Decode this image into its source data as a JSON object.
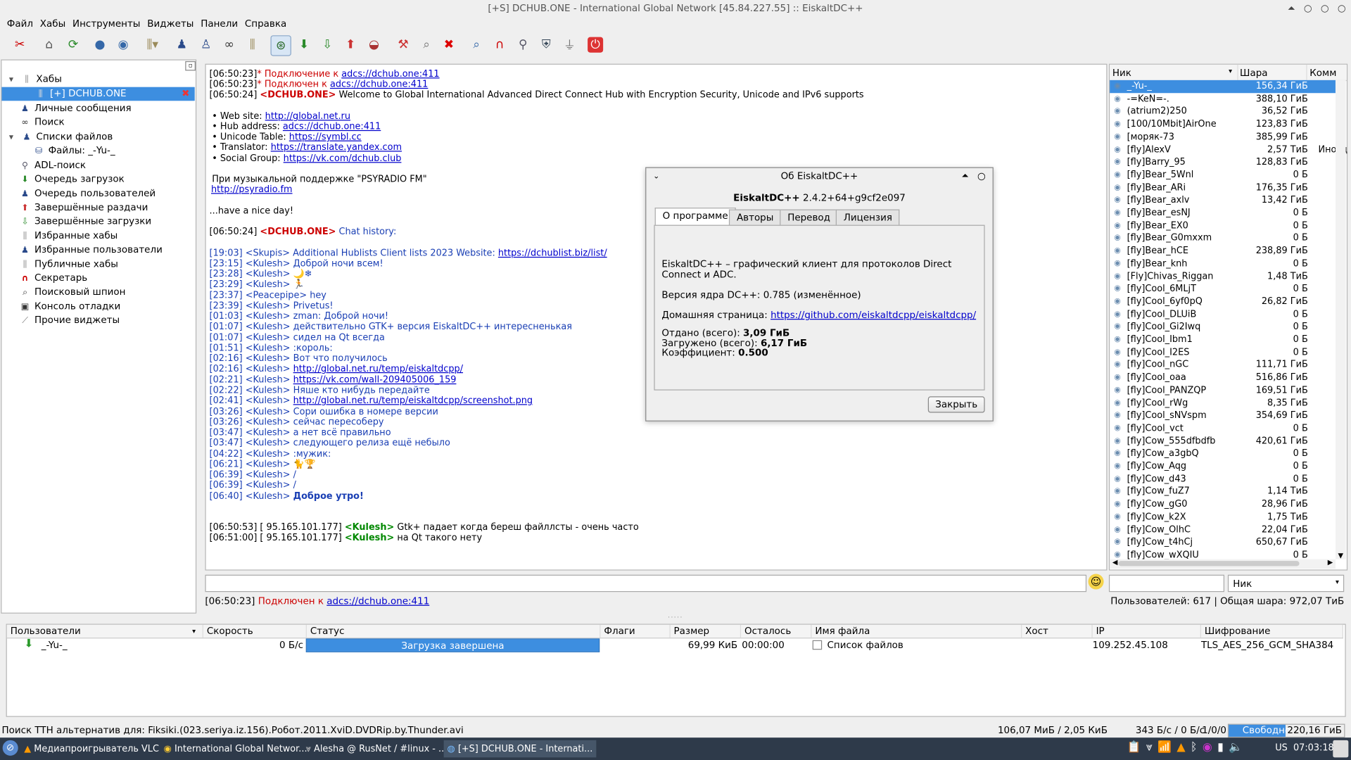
{
  "window": {
    "title": "[+S] DCHUB.ONE - International Global Network [45.84.227.55] :: EiskaltDC++"
  },
  "menu": [
    "Файл",
    "Хабы",
    "Инструменты",
    "Виджеты",
    "Панели",
    "Справка"
  ],
  "sidebar": {
    "items": [
      {
        "label": "Хабы",
        "icon": "hubs-icon"
      },
      {
        "label": "[+] DCHUB.ONE",
        "icon": "hub-connected-icon",
        "selected": true
      },
      {
        "label": "Личные сообщения",
        "icon": "user-icon"
      },
      {
        "label": "Поиск",
        "icon": "binoculars-icon"
      },
      {
        "label": "Списки файлов",
        "icon": "filelist-icon"
      },
      {
        "label": "Файлы: _-Yu-_",
        "icon": "user-icon"
      },
      {
        "label": "ADL-поиск",
        "icon": "adl-icon"
      },
      {
        "label": "Очередь загрузок",
        "icon": "download-queue-icon"
      },
      {
        "label": "Очередь пользователей",
        "icon": "user-icon"
      },
      {
        "label": "Завершённые раздачи",
        "icon": "upload-finished-icon"
      },
      {
        "label": "Завершённые загрузки",
        "icon": "download-finished-icon"
      },
      {
        "label": "Избранные хабы",
        "icon": "fav-hubs-icon"
      },
      {
        "label": "Избранные пользователи",
        "icon": "fav-users-icon"
      },
      {
        "label": "Публичные хабы",
        "icon": "public-hubs-icon"
      },
      {
        "label": "Секретарь",
        "icon": "magnet-icon"
      },
      {
        "label": "Поисковый шпион",
        "icon": "spy-icon"
      },
      {
        "label": "Консоль отладки",
        "icon": "console-icon"
      },
      {
        "label": "Прочие виджеты",
        "icon": "widgets-icon"
      }
    ]
  },
  "chat": {
    "lines": [
      {
        "ts": "[06:50:23]",
        "star": "*",
        "text": " Подключение к ",
        "link": "adcs://dchub.one:411"
      },
      {
        "ts": "[06:50:23]",
        "star": "*",
        "text": " Подключен к ",
        "link": "adcs://dchub.one:411"
      },
      {
        "ts": "[06:50:24]",
        "nick": "<DCHUB.ONE>",
        "text": " Welcome to Global International Advanced Direct Connect Hub with Encryption Security, Unicode and IPv6 supports"
      },
      {
        "text": ""
      },
      {
        "text": "• Web site: ",
        "link": "http://global.net.ru"
      },
      {
        "text": "• Hub address: ",
        "link": "adcs://dchub.one:411"
      },
      {
        "text": "• Unicode Table: ",
        "link": "https://symbl.cc"
      },
      {
        "text": "• Translator: ",
        "link": "https://translate.yandex.com"
      },
      {
        "text": "• Social Group: ",
        "link": "https://vk.com/dchub.club"
      },
      {
        "text": ""
      },
      {
        "text": "При музыкальной поддержке \"PSYRADIO FM\""
      },
      {
        "text": "",
        "link": "http://psyradio.fm"
      },
      {
        "text": ""
      },
      {
        "text": "...have a nice day!"
      },
      {
        "text": ""
      },
      {
        "ts": "[06:50:24]",
        "nick": "<DCHUB.ONE>",
        "history": " Chat history:"
      },
      {
        "text": ""
      },
      {
        "h": "[19:03] <Skupis> Additional Hublists Client lists 2023  Website:   ",
        "link": "https://dchublist.biz/list/"
      },
      {
        "h": "[23:15] <Kulesh> Доброй ночи всем!"
      },
      {
        "h": "[23:28] <Kulesh> 🌙❄"
      },
      {
        "h": "[23:29] <Kulesh> 🏃"
      },
      {
        "h": "[23:37] <Peacepipe> hey"
      },
      {
        "h": "[23:39] <Kulesh> Privetus!"
      },
      {
        "h": "[01:03] <Kulesh> zman: Доброй ночи!"
      },
      {
        "h": "[01:07] <Kulesh> действительно GTK+ версия EiskaltDC++ интересненькая"
      },
      {
        "h": "[01:07] <Kulesh> сидел на Qt всегда"
      },
      {
        "h": "[01:51] <Kulesh> :король:"
      },
      {
        "h": "[02:16] <Kulesh> Вот что получилось"
      },
      {
        "h": "[02:16] <Kulesh> ",
        "link": "http://global.net.ru/temp/eiskaltdcpp/"
      },
      {
        "h": "[02:21] <Kulesh> ",
        "link": "https://vk.com/wall-209405006_159"
      },
      {
        "h": "[02:22] <Kulesh> Няше кто нибудь передайте"
      },
      {
        "h": "[02:41] <Kulesh> ",
        "link": "http://global.net.ru/temp/eiskaltdcpp/screenshot.png"
      },
      {
        "h": "[03:26] <Kulesh> Сори ошибка в номере версии"
      },
      {
        "h": "[03:26] <Kulesh> сейчас пересоберу"
      },
      {
        "h": "[03:47] <Kulesh> а нет всё правильно"
      },
      {
        "h": "[03:47] <Kulesh> следующего релиза ещё небыло"
      },
      {
        "h": "[04:22] <Kulesh> :мужик:"
      },
      {
        "h": "[06:21] <Kulesh> 🐈🏆"
      },
      {
        "h": "[06:39] <Kulesh> /"
      },
      {
        "h": "[06:39] <Kulesh> /"
      },
      {
        "h": "[06:40] <Kulesh> ",
        "bold": "Доброе утро!"
      },
      {
        "text": ""
      },
      {
        "text": ""
      },
      {
        "ts": "[06:50:53]",
        "ip": " [ 95.165.101.177]  ",
        "gnick": "<Kulesh>",
        "text": " Gtk+ падает когда береш файллсты - очень часто"
      },
      {
        "ts": "[06:51:00]",
        "ip": " [ 95.165.101.177]  ",
        "gnick": "<Kulesh>",
        "text": " на Qt такого нету"
      }
    ]
  },
  "userlist": {
    "headers": {
      "nick": "Ник",
      "share": "Шара",
      "comment": "Комм"
    },
    "rows": [
      {
        "nick": "_-Yu-_",
        "share": "156,34 ГиБ",
        "comment": "",
        "selected": true
      },
      {
        "nick": "-=KeN=-.",
        "share": "388,10 ГиБ",
        "comment": ""
      },
      {
        "nick": "(atrium2)250",
        "share": "36,52 ГиБ",
        "comment": ""
      },
      {
        "nick": "[100/10Mbit]AirOne",
        "share": "123,83 ГиБ",
        "comment": ""
      },
      {
        "nick": "[моряк-73",
        "share": "385,99 ГиБ",
        "comment": ""
      },
      {
        "nick": "[fly]AlexV",
        "share": "2,57 ТиБ",
        "comment": "Иногд"
      },
      {
        "nick": "[fly]Barry_95",
        "share": "128,83 ГиБ",
        "comment": ""
      },
      {
        "nick": "[fly]Bear_5Wnl",
        "share": "0 Б",
        "comment": ""
      },
      {
        "nick": "[fly]Bear_ARi",
        "share": "176,35 ГиБ",
        "comment": ""
      },
      {
        "nick": "[fly]Bear_axlv",
        "share": "13,42 ГиБ",
        "comment": ""
      },
      {
        "nick": "[fly]Bear_esNJ",
        "share": "0 Б",
        "comment": ""
      },
      {
        "nick": "[fly]Bear_EX0",
        "share": "0 Б",
        "comment": ""
      },
      {
        "nick": "[fly]Bear_G0mxxm",
        "share": "0 Б",
        "comment": ""
      },
      {
        "nick": "[fly]Bear_hCE",
        "share": "238,89 ГиБ",
        "comment": ""
      },
      {
        "nick": "[fly]Bear_knh",
        "share": "0 Б",
        "comment": ""
      },
      {
        "nick": "[Fly]Chivas_Riggan",
        "share": "1,48 ТиБ",
        "comment": ""
      },
      {
        "nick": "[fly]Cool_6MLjT",
        "share": "0 Б",
        "comment": ""
      },
      {
        "nick": "[fly]Cool_6yf0pQ",
        "share": "26,82 ГиБ",
        "comment": ""
      },
      {
        "nick": "[fly]Cool_DLUiB",
        "share": "0 Б",
        "comment": ""
      },
      {
        "nick": "[fly]Cool_Gi2Iwq",
        "share": "0 Б",
        "comment": ""
      },
      {
        "nick": "[fly]Cool_Ibm1",
        "share": "0 Б",
        "comment": ""
      },
      {
        "nick": "[fly]Cool_I2ES",
        "share": "0 Б",
        "comment": ""
      },
      {
        "nick": "[fly]Cool_nGC",
        "share": "111,71 ГиБ",
        "comment": ""
      },
      {
        "nick": "[fly]Cool_oaa",
        "share": "516,86 ГиБ",
        "comment": ""
      },
      {
        "nick": "[fly]Cool_PANZQP",
        "share": "169,51 ГиБ",
        "comment": ""
      },
      {
        "nick": "[fly]Cool_rWg",
        "share": "8,35 ГиБ",
        "comment": ""
      },
      {
        "nick": "[fly]Cool_sNVspm",
        "share": "354,69 ГиБ",
        "comment": ""
      },
      {
        "nick": "[fly]Cool_vct",
        "share": "0 Б",
        "comment": ""
      },
      {
        "nick": "[fly]Cow_555dfbdfb",
        "share": "420,61 ГиБ",
        "comment": ""
      },
      {
        "nick": "[fly]Cow_a3gbQ",
        "share": "0 Б",
        "comment": ""
      },
      {
        "nick": "[fly]Cow_Aqg",
        "share": "0 Б",
        "comment": ""
      },
      {
        "nick": "[fly]Cow_d43",
        "share": "0 Б",
        "comment": ""
      },
      {
        "nick": "[fly]Cow_fuZ7",
        "share": "1,14 ТиБ",
        "comment": ""
      },
      {
        "nick": "[fly]Cow_gG0",
        "share": "28,96 ГиБ",
        "comment": ""
      },
      {
        "nick": "[fly]Cow_k2X",
        "share": "1,75 ТиБ",
        "comment": ""
      },
      {
        "nick": "[fly]Cow_OlhC",
        "share": "22,04 ГиБ",
        "comment": ""
      },
      {
        "nick": "[fly]Cow_t4hCj",
        "share": "650,67 ГиБ",
        "comment": ""
      },
      {
        "nick": "[fly]Cow_wXQIU",
        "share": "0 Б",
        "comment": ""
      }
    ]
  },
  "filter": {
    "select": "Ник"
  },
  "hub_status": {
    "ts": "[06:50:23]",
    "text": " Подключен к ",
    "link": "adcs://dchub.one:411",
    "right": "Пользователей: 617 | Общая шара: 972,07 ТиБ"
  },
  "dialog": {
    "title": "Об EiskaltDC++",
    "app": "EiskaltDC++",
    "version": " 2.4.2+64+g9cf2e097",
    "tabs": [
      "О программе",
      "Авторы",
      "Перевод",
      "Лицензия"
    ],
    "desc": "EiskaltDC++ – графический клиент для протоколов Direct Connect и ADC.",
    "core": "Версия ядра DC++: 0.785 (изменённое)",
    "home_label": "Домашняя страница: ",
    "home_link": "https://github.com/eiskaltdcpp/eiskaltdcpp/",
    "up_label": "Отдано (всего): ",
    "up_val": "3,09 ГиБ",
    "down_label": "Загружено (всего): ",
    "down_val": "6,17 ГиБ",
    "ratio_label": "Коэффициент: ",
    "ratio_val": "0.500",
    "close": "Закрыть"
  },
  "transfers": {
    "headers": [
      "Пользователи",
      "Скорость",
      "Статус",
      "Флаги",
      "Размер",
      "Осталось",
      "Имя файла",
      "Хост",
      "IP",
      "Шифрование"
    ],
    "row": {
      "user": "_-Yu-_",
      "speed": "0 Б/с",
      "status": "Загрузка завершена",
      "progress": 1.0,
      "flags": "",
      "size": "69,99 КиБ",
      "left": "00:00:00",
      "file": "Список файлов",
      "host": "",
      "ip": "109.252.45.108",
      "enc": "TLS_AES_256_GCM_SHA384"
    }
  },
  "statusbar": {
    "left": "Поиск TTH альтернатив для: Fiksiki.(023.seriya.iz.156).Робот.2011.XviD.DVDRip.by.Thunder.avi",
    "mid": "106,07 МиБ / 2,05 КиБ",
    "rate": "343 Б/с / 0 Б/с",
    "slots": "1/0/0",
    "free_label": "Свободно",
    "free_val": "220,16 ГиБ"
  },
  "taskbar": {
    "items": [
      "Медиапроигрыватель VLC",
      "International Global Networ...",
      "Alesha @ RusNet / #linux - ...",
      "[+S] DCHUB.ONE - Internati..."
    ],
    "lang": "US",
    "clock": "07:03:18"
  },
  "colors": {
    "accent": "#3d8ee0",
    "selection": "#3d8ee0",
    "link": "#0000cc",
    "hist": "#1a3fb4",
    "nick_red": "#cc0000",
    "nick_green": "#008800"
  }
}
